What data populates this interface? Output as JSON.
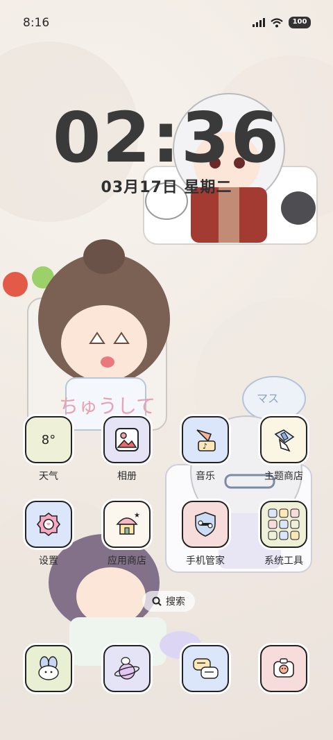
{
  "status_bar": {
    "time": "8:16",
    "battery": "100",
    "signal_icon": "signal-bars-icon",
    "wifi_icon": "wifi-icon"
  },
  "lock_clock": {
    "time": "02:36",
    "date": "03月17日 星期二"
  },
  "apps_row1": [
    {
      "label": "天气",
      "tile_text": "8°",
      "bg": "#eef0d8",
      "icon": "weather-icon"
    },
    {
      "label": "相册",
      "tile_text": "",
      "bg": "#e4e4f6",
      "icon": "photo-icon"
    },
    {
      "label": "音乐",
      "tile_text": "",
      "bg": "#dbe6fb",
      "icon": "music-icon"
    },
    {
      "label": "主题商店",
      "tile_text": "",
      "bg": "#fbf6e4",
      "icon": "theme-store-icon"
    }
  ],
  "apps_row2": [
    {
      "label": "设置",
      "bg": "#dbe6fb",
      "icon": "settings-icon"
    },
    {
      "label": "应用商店",
      "bg": "#fbf7ef",
      "icon": "app-store-icon"
    },
    {
      "label": "手机管家",
      "bg": "#f7dcdc",
      "icon": "security-shield-icon"
    },
    {
      "label": "系统工具",
      "bg": "#eef0d8",
      "icon": "system-tools-folder-icon"
    }
  ],
  "search": {
    "label": "搜索",
    "icon": "search-icon"
  },
  "dock": [
    {
      "bg": "#e9efd2",
      "icon": "messages-bunny-icon"
    },
    {
      "bg": "#e4e4f6",
      "icon": "browser-planet-icon"
    },
    {
      "bg": "#dbe6fb",
      "icon": "chat-bubbles-icon"
    },
    {
      "bg": "#f7dcdc",
      "icon": "camera-icon"
    }
  ],
  "wallpaper": {
    "sticker_text": "ちゅうして",
    "sticker_text_2": "マス",
    "accent_colors": [
      "#e6bfc4",
      "#8b4a3c",
      "#c9d6ec"
    ]
  }
}
